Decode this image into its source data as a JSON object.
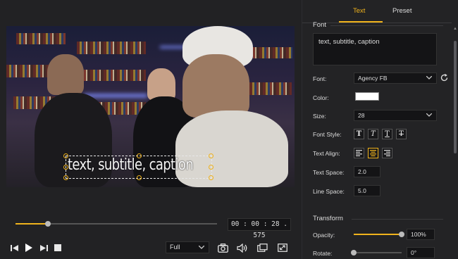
{
  "player": {
    "caption_text": "text, subtitle, caption",
    "timecode": "00 : 00 : 28 . 575",
    "progress": 0.16,
    "view_mode": "Full"
  },
  "panel": {
    "tabs": [
      {
        "label": "Text",
        "active": true
      },
      {
        "label": "Preset",
        "active": false
      }
    ],
    "font_section_title": "Font",
    "text_value": "text, subtitle, caption",
    "font_label": "Font:",
    "font_value": "Agency FB",
    "color_label": "Color:",
    "color_value": "#ffffff",
    "size_label": "Size:",
    "size_value": "28",
    "font_style_label": "Font Style:",
    "font_style_buttons": [
      "T",
      "T",
      "T",
      "T"
    ],
    "text_align_label": "Text Align:",
    "text_align_selected": "center",
    "text_space_label": "Text Space:",
    "text_space_value": "2.0",
    "line_space_label": "Line Space:",
    "line_space_value": "5.0",
    "transform_title": "Transform",
    "opacity_label": "Opacity:",
    "opacity_value": "100%",
    "opacity_level": 1.0,
    "rotate_label": "Rotate:",
    "rotate_value": "0°",
    "rotate_level": 0.0
  },
  "colors": {
    "accent": "#f0b31c",
    "background": "#1b1b1d"
  }
}
